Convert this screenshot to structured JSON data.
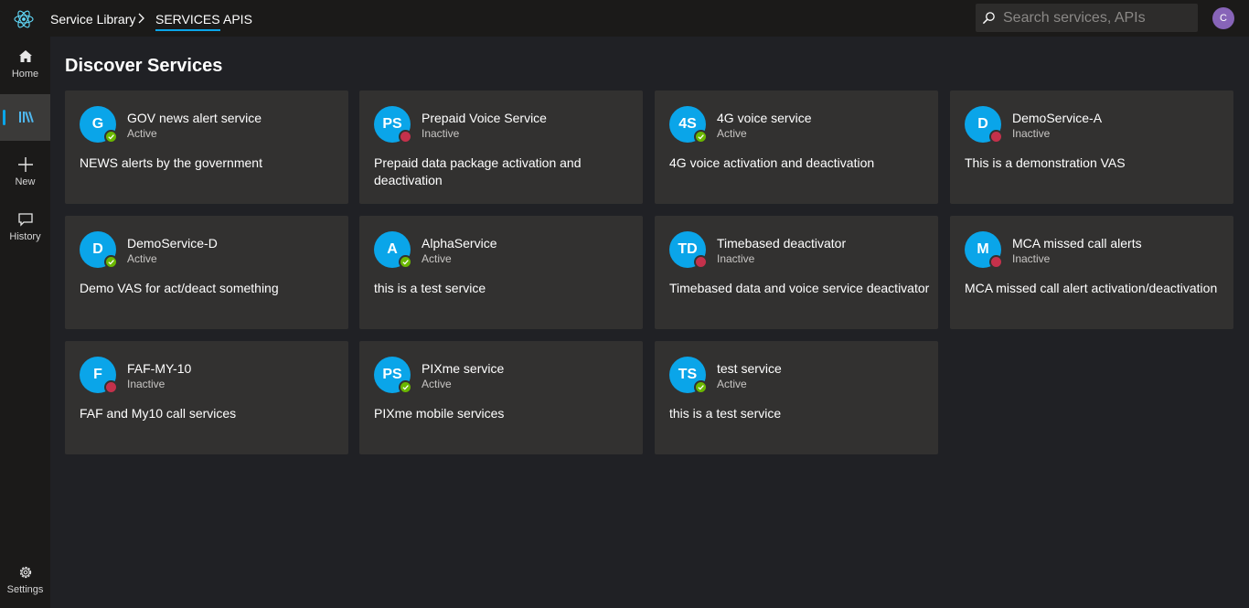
{
  "header": {
    "breadcrumb_root": "Service Library",
    "tabs": [
      {
        "label": "SERVICES",
        "active": true
      },
      {
        "label": "APIS",
        "active": false
      }
    ],
    "search_placeholder": "Search services, APIs",
    "avatar_initial": "C",
    "accent_color": "#0aa5e9"
  },
  "sidebar": {
    "items": [
      {
        "label": "Home",
        "icon": "home-icon"
      },
      {
        "label": "",
        "icon": "library-icon",
        "active": true
      },
      {
        "label": "New",
        "icon": "plus-icon"
      },
      {
        "label": "History",
        "icon": "chat-icon"
      },
      {
        "label": "Settings",
        "icon": "gear-icon"
      }
    ]
  },
  "main": {
    "title": "Discover Services",
    "services": [
      {
        "initials": "G",
        "name": "GOV news alert service",
        "status": "Active",
        "description": "NEWS alerts by the government"
      },
      {
        "initials": "PS",
        "name": "Prepaid Voice Service",
        "status": "Inactive",
        "description": "Prepaid data package activation and deactivation"
      },
      {
        "initials": "4S",
        "name": "4G voice service",
        "status": "Active",
        "description": "4G voice activation and deactivation"
      },
      {
        "initials": "D",
        "name": "DemoService-A",
        "status": "Inactive",
        "description": "This is a demonstration VAS"
      },
      {
        "initials": "D",
        "name": "DemoService-D",
        "status": "Active",
        "description": "Demo VAS for act/deact something"
      },
      {
        "initials": "A",
        "name": "AlphaService",
        "status": "Active",
        "description": "this is a test service"
      },
      {
        "initials": "TD",
        "name": "Timebased deactivator",
        "status": "Inactive",
        "description": "Timebased data and voice service deactivator"
      },
      {
        "initials": "M",
        "name": "MCA missed call alerts",
        "status": "Inactive",
        "description": "MCA missed call alert activation/deactivation"
      },
      {
        "initials": "F",
        "name": "FAF-MY-10",
        "status": "Inactive",
        "description": "FAF and My10 call services"
      },
      {
        "initials": "PS",
        "name": "PIXme service",
        "status": "Active",
        "description": "PIXme mobile services"
      },
      {
        "initials": "TS",
        "name": "test service",
        "status": "Active",
        "description": "this is a test service"
      }
    ],
    "status_colors": {
      "active": "#6bb700",
      "inactive": "#c4314b"
    }
  }
}
